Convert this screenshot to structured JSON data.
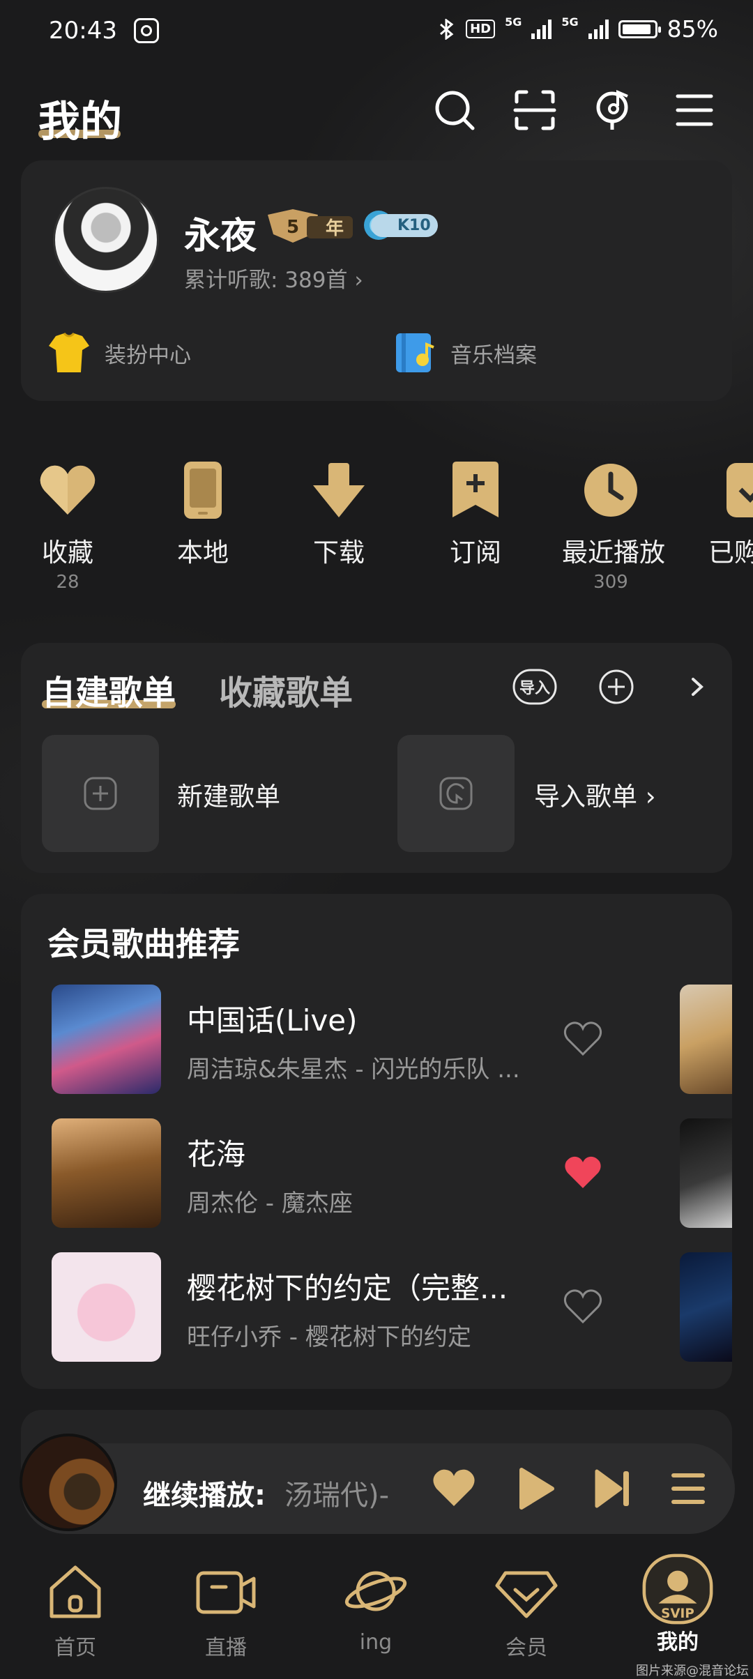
{
  "status_bar": {
    "time": "20:43",
    "hd_label": "HD",
    "net1": "5G",
    "net2": "5G",
    "battery": "85%"
  },
  "header": {
    "title": "我的",
    "icons": [
      "search-icon",
      "scan-icon",
      "recognize-music-icon",
      "menu-icon"
    ]
  },
  "profile": {
    "username": "永夜",
    "vip_year_badge": "5",
    "vip_year_text": "年",
    "level_badge": "K10",
    "listen_count": "累计听歌: 389首 ›",
    "links": [
      {
        "label": "装扮中心",
        "icon": "tshirt-icon"
      },
      {
        "label": "音乐档案",
        "icon": "music-file-icon"
      }
    ]
  },
  "quick_actions": [
    {
      "label": "收藏",
      "count": "28",
      "icon": "heart-icon"
    },
    {
      "label": "本地",
      "count": "",
      "icon": "phone-icon"
    },
    {
      "label": "下载",
      "count": "",
      "icon": "download-icon"
    },
    {
      "label": "订阅",
      "count": "",
      "icon": "subscribe-icon"
    },
    {
      "label": "最近播放",
      "count": "309",
      "icon": "clock-icon"
    },
    {
      "label": "已购",
      "count": "",
      "icon": "purchased-icon"
    }
  ],
  "playlists": {
    "tabs": [
      "自建歌单",
      "收藏歌单"
    ],
    "import_label": "导入",
    "new_label": "新建歌单",
    "import_playlist_label": "导入歌单 ›"
  },
  "recommend": {
    "title": "会员歌曲推荐",
    "songs": [
      {
        "title": "中国话(Live)",
        "artist": "周洁琼&朱星杰 - 闪光的乐队 ...",
        "liked": false
      },
      {
        "title": "花海",
        "artist": "周杰伦 - 魔杰座",
        "liked": true
      },
      {
        "title": "樱花树下的约定（完整...",
        "artist": "旺仔小乔 - 樱花树下的约定",
        "liked": false
      }
    ]
  },
  "mini_player": {
    "prefix": "继续播放:",
    "song": "汤瑞代)-"
  },
  "tab_bar": [
    {
      "label": "首页",
      "icon": "home-icon",
      "active": false
    },
    {
      "label": "直播",
      "icon": "live-video-icon",
      "active": false
    },
    {
      "label": "ing",
      "icon": "planet-icon",
      "active": false
    },
    {
      "label": "会员",
      "icon": "vip-diamond-icon",
      "active": false
    },
    {
      "label": "我的",
      "icon": "svip-profile-icon",
      "active": true,
      "badge": "SVIP"
    }
  ],
  "watermark": "图片来源@混音论坛",
  "colors": {
    "background": "#1b1b1c",
    "card": "#242425",
    "gold": "#c4a46a",
    "like_red": "#f0455a"
  }
}
